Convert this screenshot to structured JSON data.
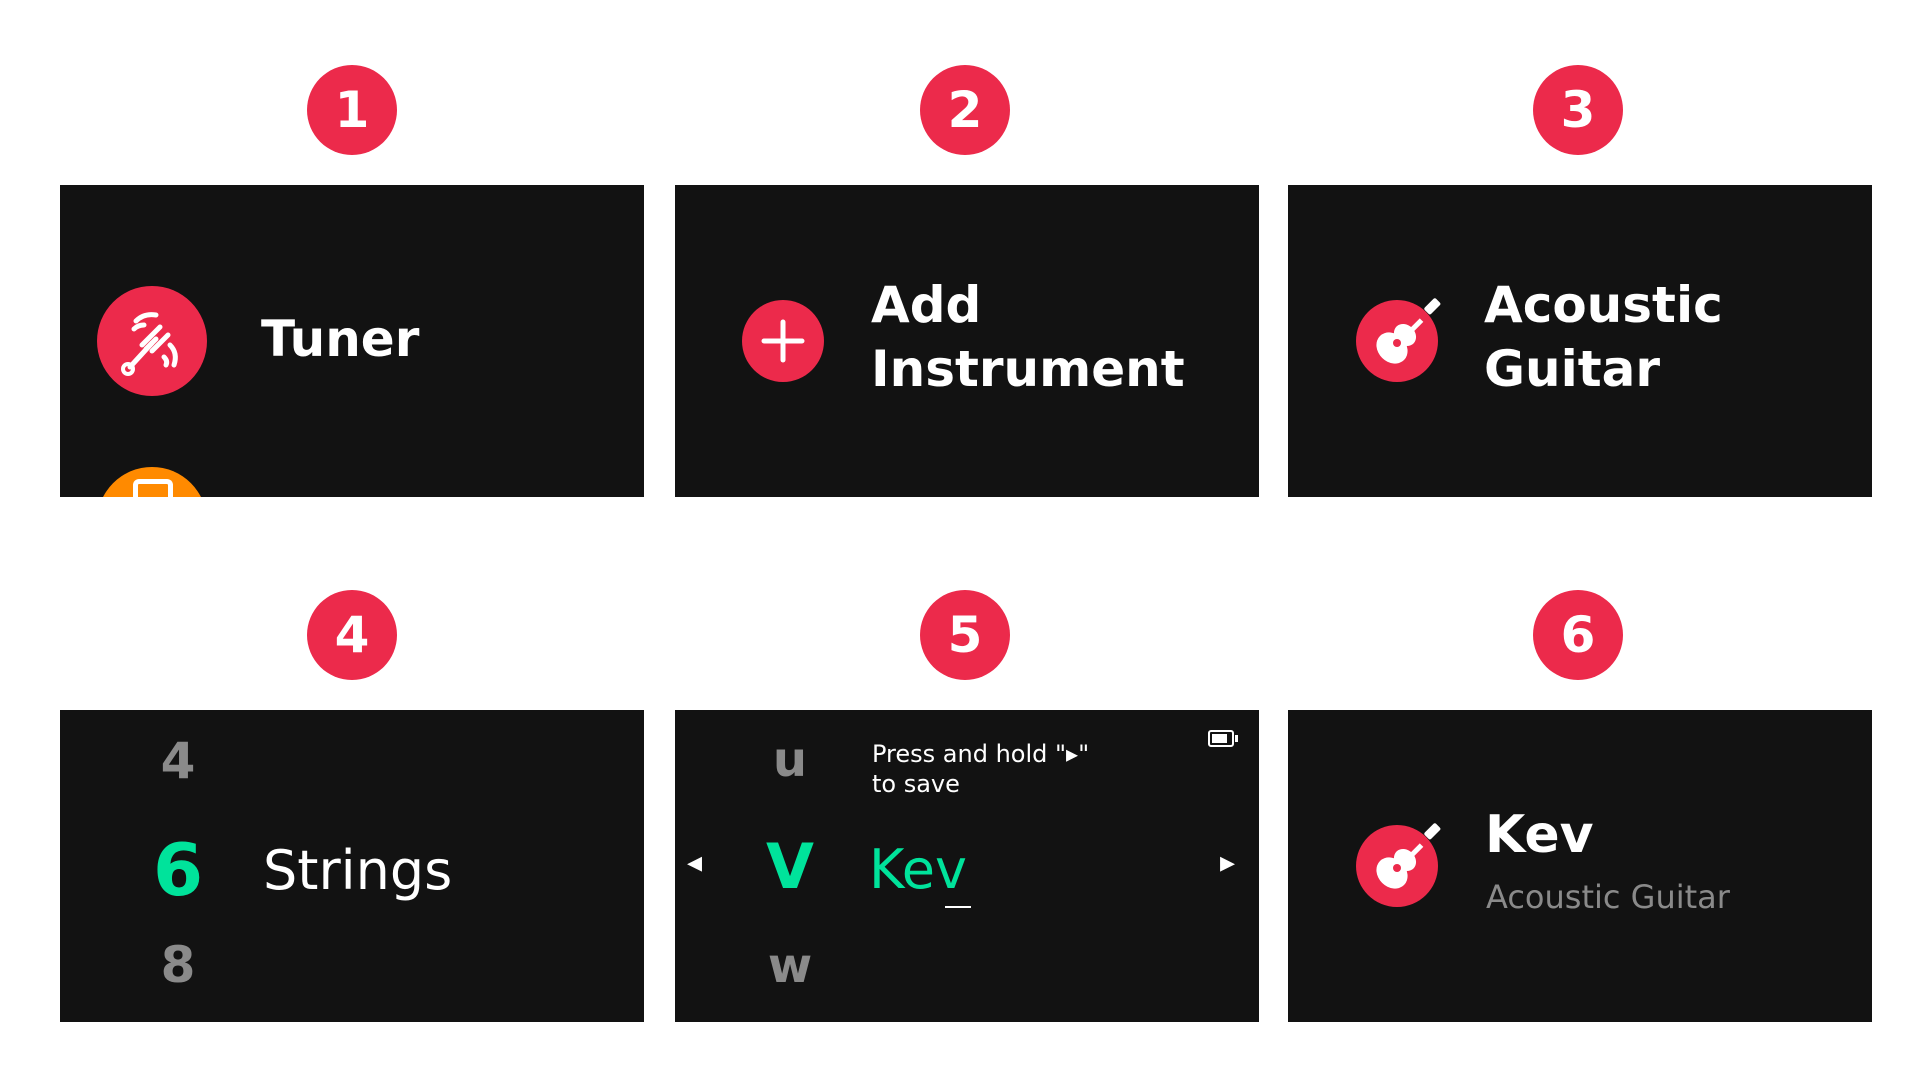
{
  "steps": [
    {
      "number": "1",
      "label": "Tuner"
    },
    {
      "number": "2",
      "line1": "Add",
      "line2": "Instrument"
    },
    {
      "number": "3",
      "line1": "Acoustic",
      "line2": "Guitar"
    },
    {
      "number": "4",
      "prev": "4",
      "current": "6",
      "next": "8",
      "label": "Strings"
    },
    {
      "number": "5",
      "hint_line1": "Press and hold \"▸\"",
      "hint_line2": "to save",
      "prev_letter": "u",
      "current_letter": "V",
      "next_letter": "w",
      "name_value": "Kev",
      "left_arrow": "◂",
      "right_arrow": "▸"
    },
    {
      "number": "6",
      "name": "Kev",
      "instrument": "Acoustic Guitar"
    }
  ],
  "colors": {
    "accent": "#ec2a4b",
    "panel": "#121212",
    "green": "#00e39b",
    "orange": "#ff8a00",
    "dim": "#8a8a8a"
  }
}
